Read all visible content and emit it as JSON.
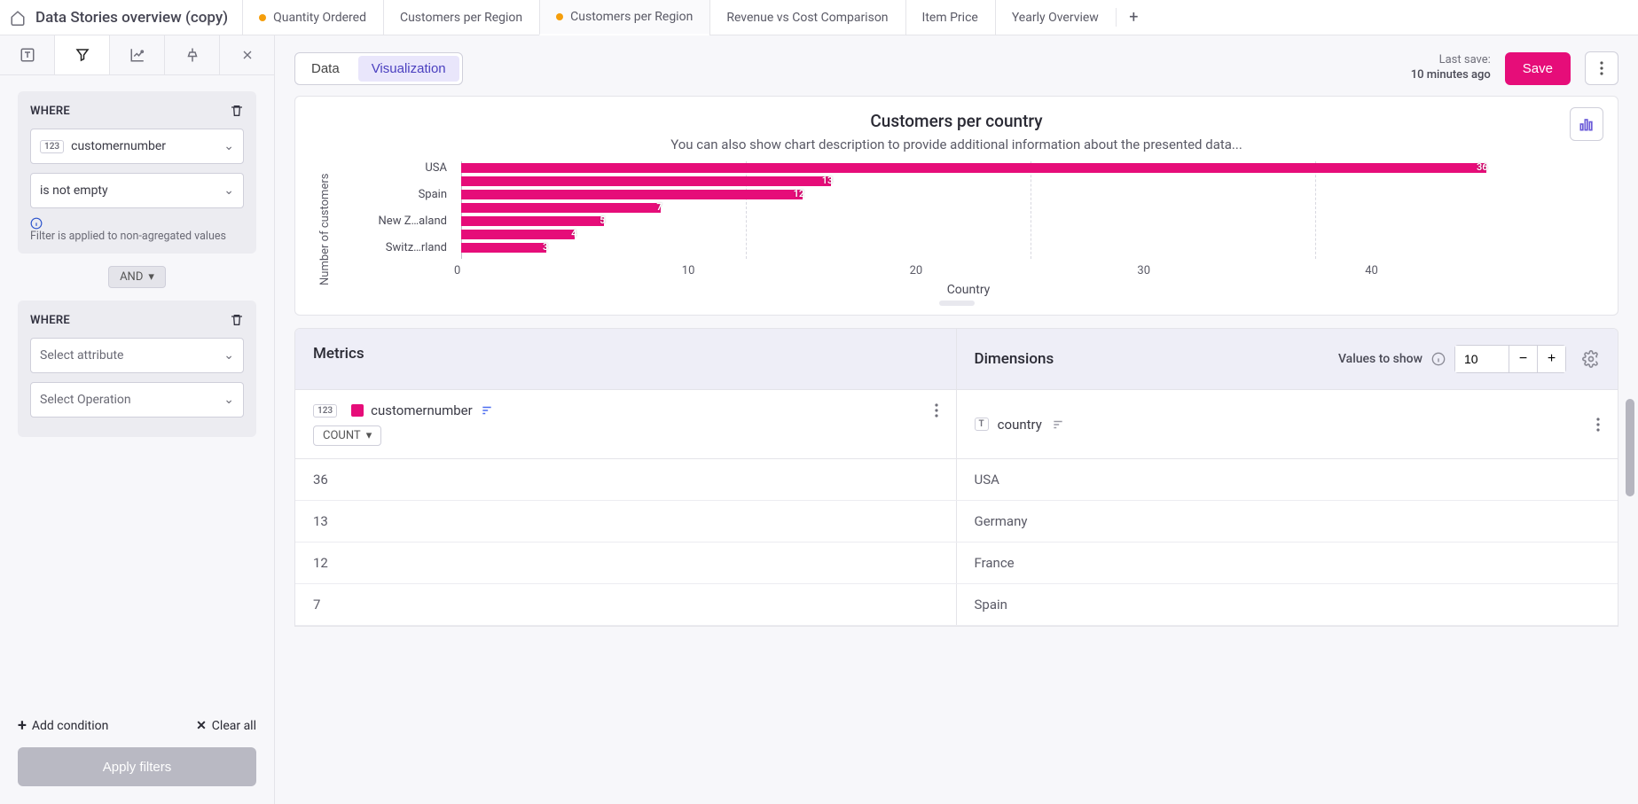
{
  "header": {
    "title": "Data Stories overview (copy)",
    "tabs": [
      {
        "label": "Quantity Ordered",
        "dot": true,
        "active": false
      },
      {
        "label": "Customers per Region",
        "dot": false,
        "active": false
      },
      {
        "label": "Customers per Region",
        "dot": true,
        "active": true
      },
      {
        "label": "Revenue vs Cost Comparison",
        "dot": false,
        "active": false
      },
      {
        "label": "Item Price",
        "dot": false,
        "active": false
      },
      {
        "label": "Yearly Overview",
        "dot": false,
        "active": false
      }
    ]
  },
  "filters": {
    "where_label": "WHERE",
    "block1": {
      "attribute": "customernumber",
      "operation": "is not empty",
      "info": "Filter is applied to non-agregated values"
    },
    "and_label": "AND",
    "block2": {
      "attribute_placeholder": "Select attribute",
      "operation_placeholder": "Select Operation"
    },
    "add_condition": "Add condition",
    "clear_all": "Clear all",
    "apply": "Apply filters"
  },
  "toolbar": {
    "data_label": "Data",
    "viz_label": "Visualization",
    "last_save_label": "Last save:",
    "last_save_value": "10 minutes ago",
    "save": "Save"
  },
  "chart_data": {
    "type": "bar",
    "orientation": "horizontal",
    "title": "Customers per country",
    "subtitle": "You can also show chart description to provide additional information about the presented data...",
    "ylabel": "Number of customers",
    "xlabel": "Country",
    "xlim": [
      0,
      40
    ],
    "xticks": [
      0,
      10,
      20,
      30,
      40
    ],
    "categories": [
      "USA",
      "",
      "Spain",
      "",
      "New Z…aland",
      "",
      "Switz…rland"
    ],
    "values": [
      36,
      13,
      12,
      7,
      5,
      4,
      3
    ],
    "color": "#e60d79"
  },
  "table": {
    "metrics_label": "Metrics",
    "dimensions_label": "Dimensions",
    "values_to_show_label": "Values to show",
    "values_to_show": "10",
    "metric": {
      "name": "customernumber",
      "aggregation": "COUNT"
    },
    "dimension": {
      "name": "country"
    },
    "rows": [
      {
        "metric": "36",
        "dimension": "USA"
      },
      {
        "metric": "13",
        "dimension": "Germany"
      },
      {
        "metric": "12",
        "dimension": "France"
      },
      {
        "metric": "7",
        "dimension": "Spain"
      }
    ]
  }
}
